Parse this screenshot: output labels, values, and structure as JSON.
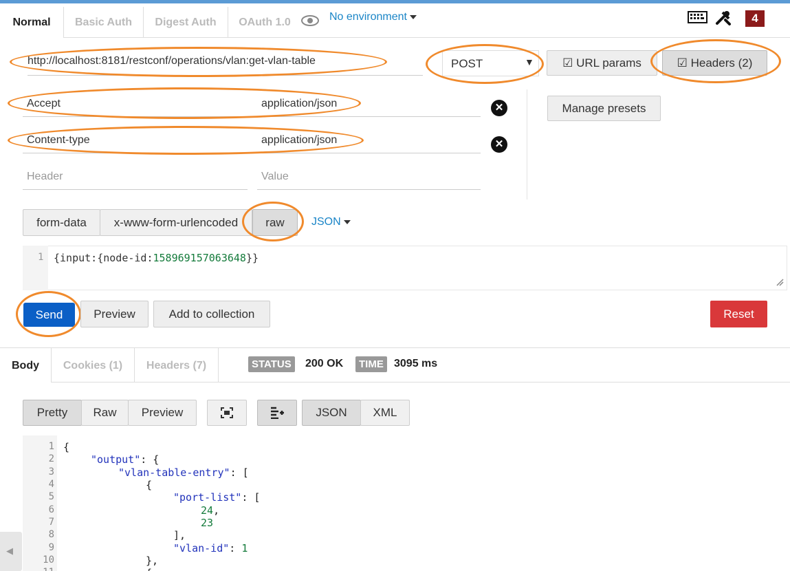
{
  "top_tabs": [
    "Normal",
    "Basic Auth",
    "Digest Auth",
    "OAuth 1.0"
  ],
  "environment": {
    "label": "No environment"
  },
  "notification_count": "4",
  "request": {
    "url": "http://localhost:8181/restconf/operations/vlan:get-vlan-table",
    "method": "POST",
    "url_params_label": "URL params",
    "headers_label": "Headers (2)",
    "manage_presets_label": "Manage presets"
  },
  "headers": [
    {
      "key": "Accept",
      "value": "application/json"
    },
    {
      "key": "Content-type",
      "value": "application/json"
    }
  ],
  "new_header": {
    "key_placeholder": "Header",
    "value_placeholder": "Value"
  },
  "body_tabs": {
    "form_data": "form-data",
    "urlencoded": "x-www-form-urlencoded",
    "raw": "raw",
    "format": "JSON"
  },
  "raw_body": {
    "line_number": "1",
    "prefix": "{input:{node-id:",
    "node_id": "158969157063648",
    "suffix": "}}"
  },
  "actions": {
    "send": "Send",
    "preview": "Preview",
    "add_to_collection": "Add to collection",
    "reset": "Reset"
  },
  "response": {
    "tabs": {
      "body": "Body",
      "cookies": "Cookies (1)",
      "headers": "Headers (7)"
    },
    "status_label": "STATUS",
    "status_value": "200 OK",
    "time_label": "TIME",
    "time_value": "3095 ms",
    "view_modes": [
      "Pretty",
      "Raw",
      "Preview"
    ],
    "formats": [
      "JSON",
      "XML"
    ]
  },
  "response_lines": [
    {
      "n": "1",
      "text": "{"
    },
    {
      "n": "2",
      "key": "\"output\"",
      "rest": ": {"
    },
    {
      "n": "3",
      "key": "\"vlan-table-entry\"",
      "rest": ": ["
    },
    {
      "n": "4",
      "text": "{"
    },
    {
      "n": "5",
      "key": "\"port-list\"",
      "rest": ": ["
    },
    {
      "n": "6",
      "num": "24",
      "rest": ","
    },
    {
      "n": "7",
      "num": "23"
    },
    {
      "n": "8",
      "text": "],"
    },
    {
      "n": "9",
      "key": "\"vlan-id\"",
      "rest": ": ",
      "num": "1"
    },
    {
      "n": "10",
      "text": "},"
    },
    {
      "n": "11",
      "text": "{"
    }
  ],
  "colors": {
    "highlight": "#f08a2c",
    "send": "#0b5fc6",
    "reset": "#d9383a",
    "link": "#1a85c7"
  }
}
